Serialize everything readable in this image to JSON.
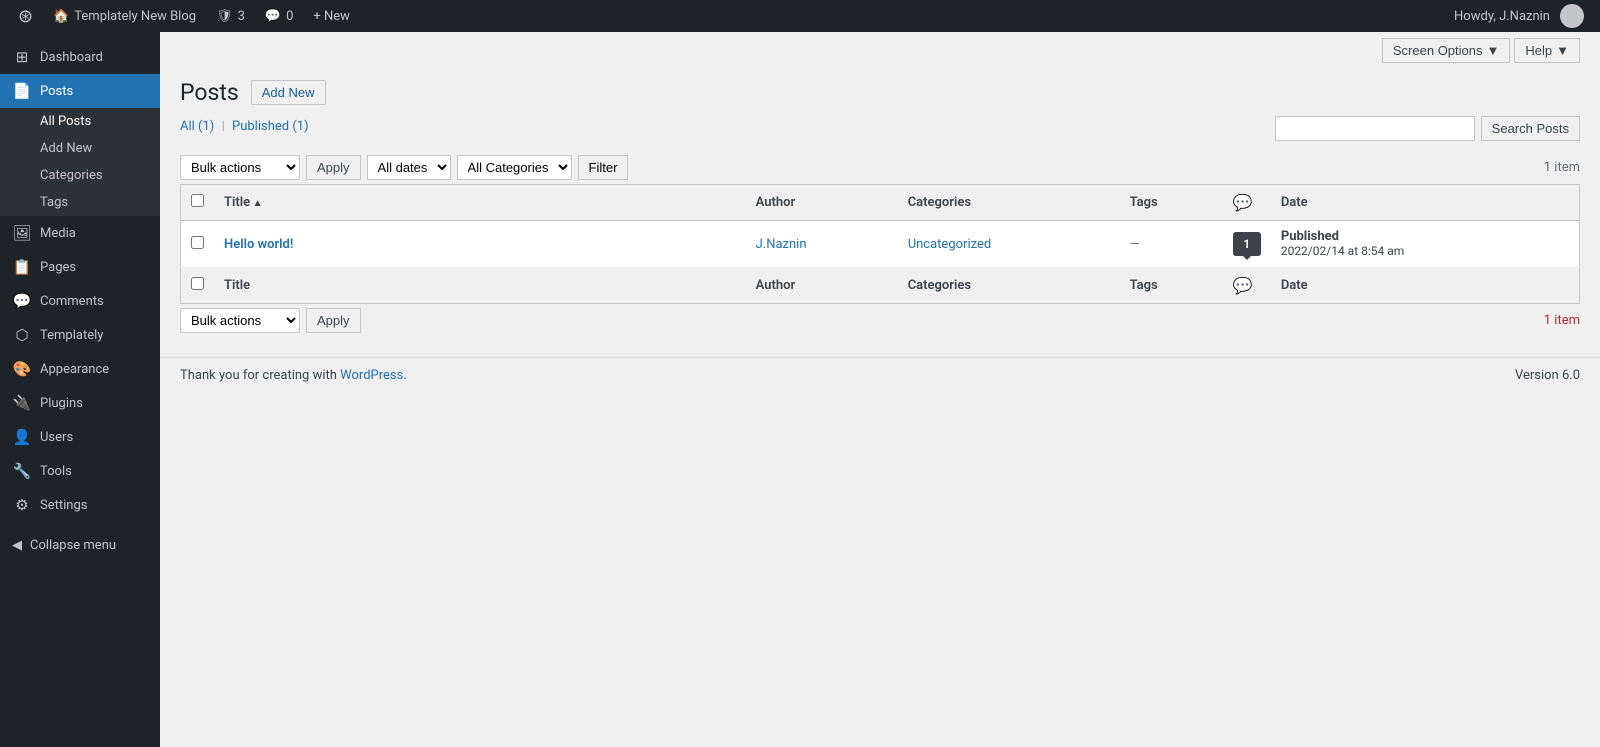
{
  "adminbar": {
    "site_name": "Templately New Blog",
    "updates_count": "3",
    "comments_count": "0",
    "new_label": "+ New",
    "howdy": "Howdy, J.Naznin",
    "screen_options": "Screen Options",
    "help": "Help"
  },
  "sidebar": {
    "items": [
      {
        "id": "dashboard",
        "label": "Dashboard",
        "icon": "⊞"
      },
      {
        "id": "posts",
        "label": "Posts",
        "icon": "📄",
        "active": true
      },
      {
        "id": "media",
        "label": "Media",
        "icon": "🖼"
      },
      {
        "id": "pages",
        "label": "Pages",
        "icon": "📋"
      },
      {
        "id": "comments",
        "label": "Comments",
        "icon": "💬"
      },
      {
        "id": "templately",
        "label": "Templately",
        "icon": "⬡"
      },
      {
        "id": "appearance",
        "label": "Appearance",
        "icon": "🎨"
      },
      {
        "id": "plugins",
        "label": "Plugins",
        "icon": "🔌"
      },
      {
        "id": "users",
        "label": "Users",
        "icon": "👤"
      },
      {
        "id": "tools",
        "label": "Tools",
        "icon": "🔧"
      },
      {
        "id": "settings",
        "label": "Settings",
        "icon": "⚙"
      }
    ],
    "submenu_posts": [
      {
        "id": "all-posts",
        "label": "All Posts",
        "active": true
      },
      {
        "id": "add-new",
        "label": "Add New"
      },
      {
        "id": "categories",
        "label": "Categories"
      },
      {
        "id": "tags",
        "label": "Tags"
      }
    ],
    "collapse_label": "Collapse menu"
  },
  "page": {
    "title": "Posts",
    "add_new_label": "Add New"
  },
  "filter_bar": {
    "bulk_actions_label": "Bulk actions",
    "apply_label": "Apply",
    "all_dates_label": "All dates",
    "all_categories_label": "All Categories",
    "filter_label": "Filter",
    "date_options": [
      "All dates"
    ],
    "category_options": [
      "All Categories"
    ]
  },
  "search": {
    "placeholder": "",
    "button_label": "Search Posts"
  },
  "subsubsub": {
    "all_label": "All",
    "all_count": "(1)",
    "published_label": "Published",
    "published_count": "(1)"
  },
  "item_count_top": "1 item",
  "item_count_bottom": "1 item",
  "table": {
    "columns": [
      {
        "id": "title",
        "label": "Title",
        "sortable": true,
        "sort_asc": true
      },
      {
        "id": "author",
        "label": "Author"
      },
      {
        "id": "categories",
        "label": "Categories"
      },
      {
        "id": "tags",
        "label": "Tags"
      },
      {
        "id": "comments",
        "label": "💬",
        "is_icon": true
      },
      {
        "id": "date",
        "label": "Date"
      }
    ],
    "rows": [
      {
        "id": "1",
        "title": "Hello world!",
        "title_link": "#",
        "author": "J.Naznin",
        "author_link": "#",
        "category": "Uncategorized",
        "category_link": "#",
        "tags": "—",
        "comments": "1",
        "date_status": "Published",
        "date_value": "2022/02/14 at 8:54 am"
      }
    ]
  },
  "footer": {
    "thank_you_text": "Thank you for creating with ",
    "wordpress_link_label": "WordPress",
    "version": "Version 6.0"
  }
}
